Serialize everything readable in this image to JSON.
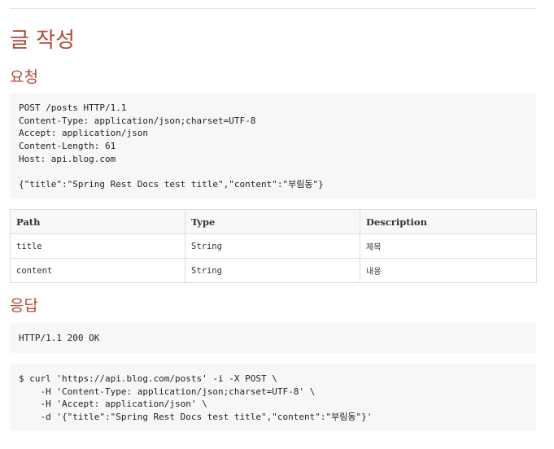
{
  "title": "글 작성",
  "request_heading": "요청",
  "request_code": "POST /posts HTTP/1.1\nContent-Type: application/json;charset=UTF-8\nAccept: application/json\nContent-Length: 61\nHost: api.blog.com\n\n{\"title\":\"Spring Rest Docs test title\",\"content\":\"부림동\"}",
  "table": {
    "headers": [
      "Path",
      "Type",
      "Description"
    ],
    "rows": [
      {
        "path": "title",
        "type": "String",
        "description": "제목"
      },
      {
        "path": "content",
        "type": "String",
        "description": "내용"
      }
    ]
  },
  "response_heading": "응답",
  "response_code": "HTTP/1.1 200 OK",
  "curl_code": "$ curl 'https://api.blog.com/posts' -i -X POST \\\n    -H 'Content-Type: application/json;charset=UTF-8' \\\n    -H 'Accept: application/json' \\\n    -d '{\"title\":\"Spring Rest Docs test title\",\"content\":\"부림동\"}'"
}
